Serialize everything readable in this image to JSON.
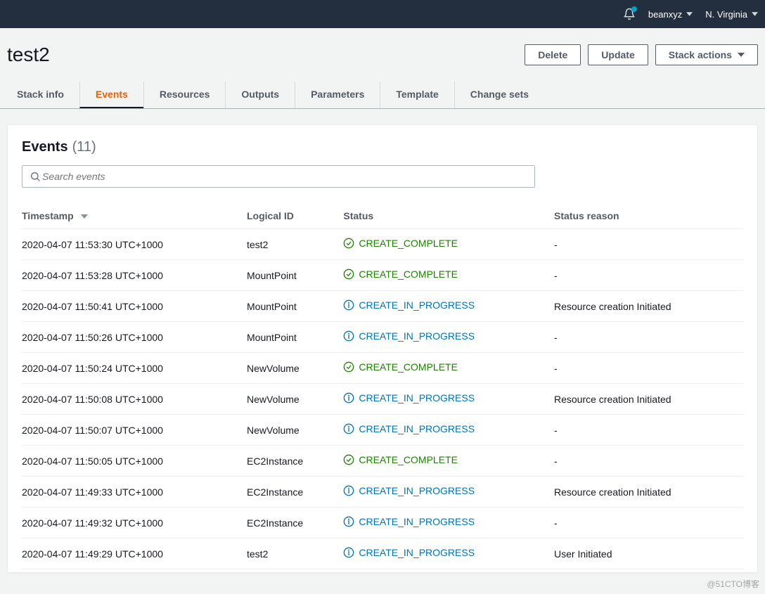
{
  "topnav": {
    "account": "beanxyz",
    "region": "N. Virginia"
  },
  "page": {
    "title": "test2",
    "buttons": {
      "delete": "Delete",
      "update": "Update",
      "stack_actions": "Stack actions"
    }
  },
  "tabs": {
    "items": [
      {
        "label": "Stack info",
        "active": false
      },
      {
        "label": "Events",
        "active": true
      },
      {
        "label": "Resources",
        "active": false
      },
      {
        "label": "Outputs",
        "active": false
      },
      {
        "label": "Parameters",
        "active": false
      },
      {
        "label": "Template",
        "active": false
      },
      {
        "label": "Change sets",
        "active": false
      }
    ]
  },
  "events": {
    "title": "Events",
    "count": "(11)",
    "search_placeholder": "Search events",
    "columns": {
      "timestamp": "Timestamp",
      "logical_id": "Logical ID",
      "status": "Status",
      "status_reason": "Status reason"
    },
    "rows": [
      {
        "timestamp": "2020-04-07 11:53:30 UTC+1000",
        "logical_id": "test2",
        "status": "CREATE_COMPLETE",
        "status_type": "complete",
        "reason": "-"
      },
      {
        "timestamp": "2020-04-07 11:53:28 UTC+1000",
        "logical_id": "MountPoint",
        "status": "CREATE_COMPLETE",
        "status_type": "complete",
        "reason": "-"
      },
      {
        "timestamp": "2020-04-07 11:50:41 UTC+1000",
        "logical_id": "MountPoint",
        "status": "CREATE_IN_PROGRESS",
        "status_type": "progress",
        "reason": "Resource creation Initiated"
      },
      {
        "timestamp": "2020-04-07 11:50:26 UTC+1000",
        "logical_id": "MountPoint",
        "status": "CREATE_IN_PROGRESS",
        "status_type": "progress",
        "reason": "-"
      },
      {
        "timestamp": "2020-04-07 11:50:24 UTC+1000",
        "logical_id": "NewVolume",
        "status": "CREATE_COMPLETE",
        "status_type": "complete",
        "reason": "-"
      },
      {
        "timestamp": "2020-04-07 11:50:08 UTC+1000",
        "logical_id": "NewVolume",
        "status": "CREATE_IN_PROGRESS",
        "status_type": "progress",
        "reason": "Resource creation Initiated"
      },
      {
        "timestamp": "2020-04-07 11:50:07 UTC+1000",
        "logical_id": "NewVolume",
        "status": "CREATE_IN_PROGRESS",
        "status_type": "progress",
        "reason": "-"
      },
      {
        "timestamp": "2020-04-07 11:50:05 UTC+1000",
        "logical_id": "EC2Instance",
        "status": "CREATE_COMPLETE",
        "status_type": "complete",
        "reason": "-"
      },
      {
        "timestamp": "2020-04-07 11:49:33 UTC+1000",
        "logical_id": "EC2Instance",
        "status": "CREATE_IN_PROGRESS",
        "status_type": "progress",
        "reason": "Resource creation Initiated"
      },
      {
        "timestamp": "2020-04-07 11:49:32 UTC+1000",
        "logical_id": "EC2Instance",
        "status": "CREATE_IN_PROGRESS",
        "status_type": "progress",
        "reason": "-"
      },
      {
        "timestamp": "2020-04-07 11:49:29 UTC+1000",
        "logical_id": "test2",
        "status": "CREATE_IN_PROGRESS",
        "status_type": "progress",
        "reason": "User Initiated"
      }
    ]
  },
  "watermark": "@51CTO博客"
}
